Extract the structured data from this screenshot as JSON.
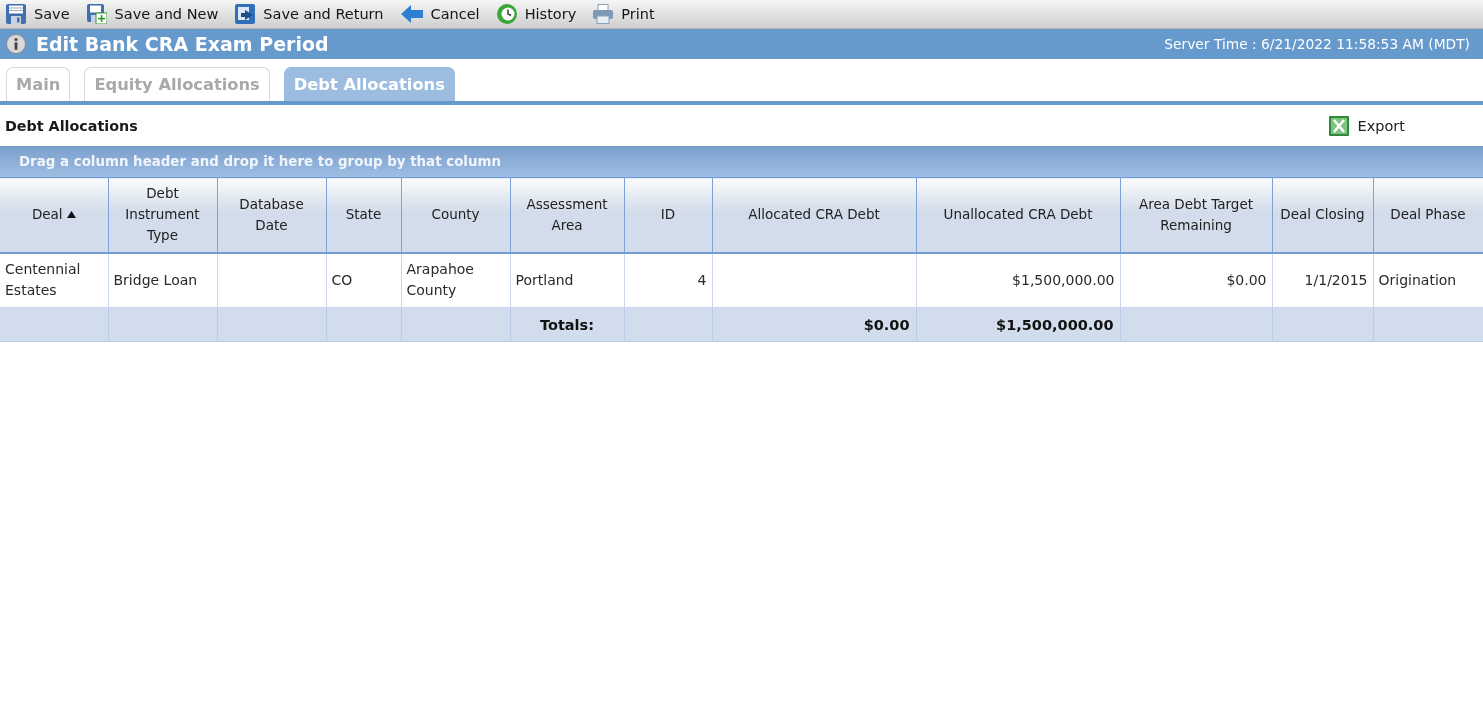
{
  "toolbar": [
    {
      "label": "Save"
    },
    {
      "label": "Save and New"
    },
    {
      "label": "Save and Return"
    },
    {
      "label": "Cancel"
    },
    {
      "label": "History"
    },
    {
      "label": "Print"
    }
  ],
  "header": {
    "title": "Edit Bank CRA Exam Period",
    "server_time": "Server Time : 6/21/2022 11:58:53 AM (MDT)"
  },
  "tabs": [
    {
      "label": "Main",
      "selected": false
    },
    {
      "label": "Equity Allocations",
      "selected": false
    },
    {
      "label": "Debt Allocations",
      "selected": true
    }
  ],
  "section": {
    "title": "Debt Allocations",
    "export": "Export"
  },
  "grid": {
    "group_hint": "Drag a column header and drop it here to group by that column",
    "columns": [
      {
        "label": "Deal",
        "kind": "text",
        "sorted": true
      },
      {
        "label": "Debt Instrument Type",
        "kind": "text",
        "sorted": false
      },
      {
        "label": "Database Date",
        "kind": "text",
        "sorted": false
      },
      {
        "label": "State",
        "kind": "text",
        "sorted": false
      },
      {
        "label": "County",
        "kind": "text",
        "sorted": false
      },
      {
        "label": "Assessment Area",
        "kind": "text",
        "sorted": false,
        "footer": "Totals:"
      },
      {
        "label": "ID",
        "kind": "number",
        "sorted": false
      },
      {
        "label": "Allocated CRA Debt",
        "kind": "number",
        "sorted": false,
        "footer": "$0.00"
      },
      {
        "label": "Unallocated CRA Debt",
        "kind": "number",
        "sorted": false,
        "footer": "$1,500,000.00"
      },
      {
        "label": "Area Debt Target Remaining",
        "kind": "number",
        "sorted": false
      },
      {
        "label": "Deal Closing",
        "kind": "number",
        "sorted": false
      },
      {
        "label": "Deal Phase",
        "kind": "text",
        "sorted": false
      }
    ],
    "rows": [
      {
        "cells": [
          "Centennial Estates",
          "Bridge Loan",
          null,
          "CO",
          "Arapahoe County",
          "Portland",
          "4",
          null,
          "$1,500,000.00",
          "$0.00",
          "1/1/2015",
          "Origination"
        ]
      }
    ]
  }
}
